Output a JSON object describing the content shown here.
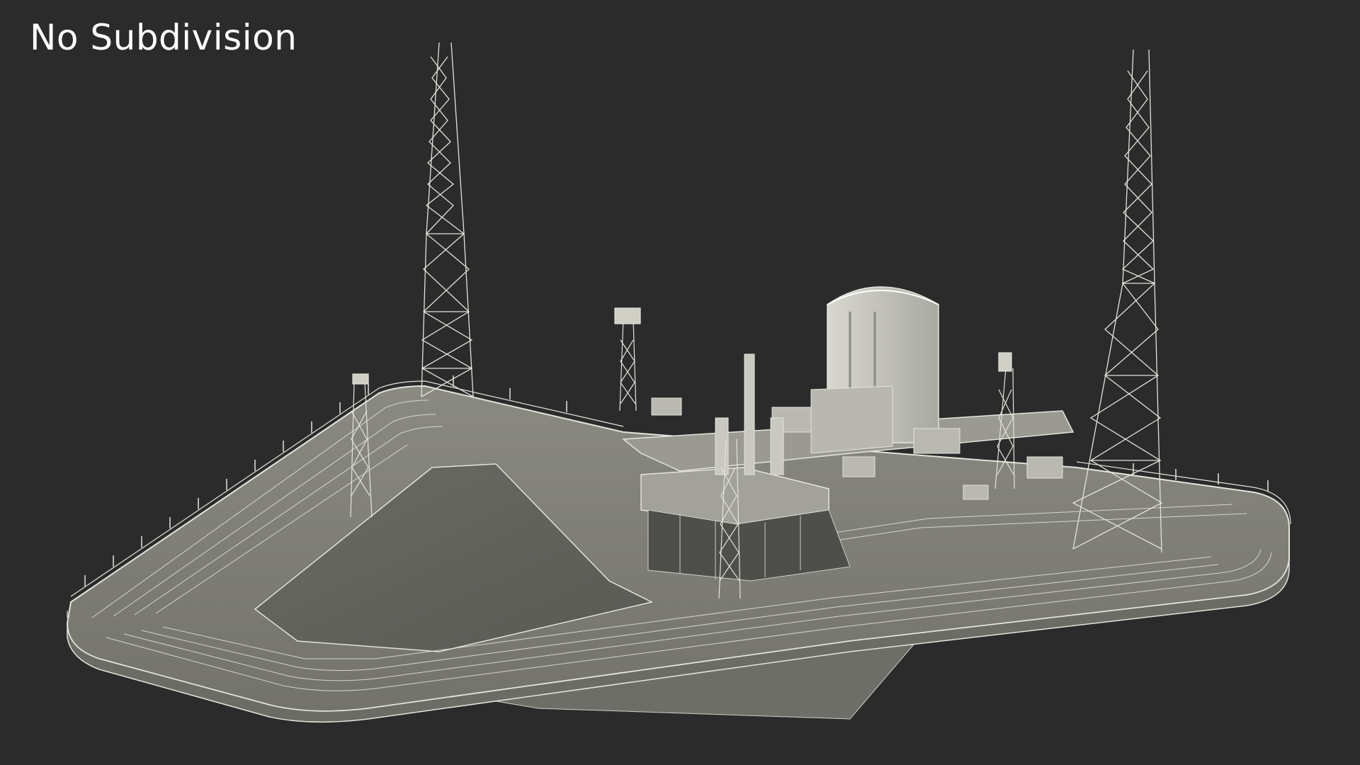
{
  "render": {
    "label": "No Subdivision",
    "subject": "launch-pad-wireframe-model",
    "background_color": "#2a2b2a",
    "surface_color": "#7d7d76",
    "wire_color": "#e4e4dc"
  }
}
